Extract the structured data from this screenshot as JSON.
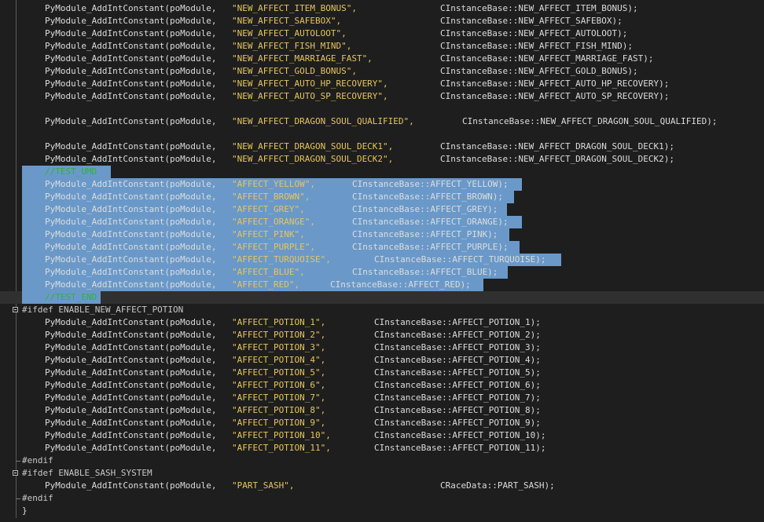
{
  "editor": {
    "lines": [
      {
        "kind": "call",
        "fn": "PyModule_AddIntConstant(poModule,",
        "str": "\"NEW_AFFECT_ITEM_BONUS\",",
        "ref": "CInstanceBase::NEW_AFFECT_ITEM_BONUS);"
      },
      {
        "kind": "call",
        "fn": "PyModule_AddIntConstant(poModule,",
        "str": "\"NEW_AFFECT_SAFEBOX\",",
        "ref": "CInstanceBase::NEW_AFFECT_SAFEBOX);"
      },
      {
        "kind": "call",
        "fn": "PyModule_AddIntConstant(poModule,",
        "str": "\"NEW_AFFECT_AUTOLOOT\",",
        "ref": "CInstanceBase::NEW_AFFECT_AUTOLOOT);"
      },
      {
        "kind": "call",
        "fn": "PyModule_AddIntConstant(poModule,",
        "str": "\"NEW_AFFECT_FISH_MIND\",",
        "ref": "CInstanceBase::NEW_AFFECT_FISH_MIND);"
      },
      {
        "kind": "call",
        "fn": "PyModule_AddIntConstant(poModule,",
        "str": "\"NEW_AFFECT_MARRIAGE_FAST\",",
        "ref": "CInstanceBase::NEW_AFFECT_MARRIAGE_FAST);"
      },
      {
        "kind": "call",
        "fn": "PyModule_AddIntConstant(poModule,",
        "str": "\"NEW_AFFECT_GOLD_BONUS\",",
        "ref": "CInstanceBase::NEW_AFFECT_GOLD_BONUS);"
      },
      {
        "kind": "call",
        "fn": "PyModule_AddIntConstant(poModule,",
        "str": "\"NEW_AFFECT_AUTO_HP_RECOVERY\",",
        "ref": "CInstanceBase::NEW_AFFECT_AUTO_HP_RECOVERY);"
      },
      {
        "kind": "call",
        "fn": "PyModule_AddIntConstant(poModule,",
        "str": "\"NEW_AFFECT_AUTO_SP_RECOVERY\",",
        "ref": "CInstanceBase::NEW_AFFECT_AUTO_SP_RECOVERY);"
      },
      {
        "kind": "blank"
      },
      {
        "kind": "call",
        "fn": "PyModule_AddIntConstant(poModule,",
        "str": "\"NEW_AFFECT_DRAGON_SOUL_QUALIFIED\",",
        "ref": "CInstanceBase::NEW_AFFECT_DRAGON_SOUL_QUALIFIED);"
      },
      {
        "kind": "blank"
      },
      {
        "kind": "call",
        "fn": "PyModule_AddIntConstant(poModule,",
        "str": "\"NEW_AFFECT_DRAGON_SOUL_DECK1\",",
        "ref": "CInstanceBase::NEW_AFFECT_DRAGON_SOUL_DECK1);"
      },
      {
        "kind": "call",
        "fn": "PyModule_AddIntConstant(poModule,",
        "str": "\"NEW_AFFECT_DRAGON_SOUL_DECK2\",",
        "ref": "CInstanceBase::NEW_AFFECT_DRAGON_SOUL_DECK2);"
      },
      {
        "kind": "comment",
        "text": "//TEST_UMD"
      },
      {
        "kind": "call",
        "fn": "PyModule_AddIntConstant(poModule,",
        "str": "\"AFFECT_YELLOW\",",
        "ref": "CInstanceBase::AFFECT_YELLOW);"
      },
      {
        "kind": "call",
        "fn": "PyModule_AddIntConstant(poModule,",
        "str": "\"AFFECT_BROWN\",",
        "ref": "CInstanceBase::AFFECT_BROWN);"
      },
      {
        "kind": "call",
        "fn": "PyModule_AddIntConstant(poModule,",
        "str": "\"AFFECT_GREY\",",
        "ref": "CInstanceBase::AFFECT_GREY);"
      },
      {
        "kind": "call",
        "fn": "PyModule_AddIntConstant(poModule,",
        "str": "\"AFFECT_ORANGE\",",
        "ref": "CInstanceBase::AFFECT_ORANGE);"
      },
      {
        "kind": "call",
        "fn": "PyModule_AddIntConstant(poModule,",
        "str": "\"AFFECT_PINK\",",
        "ref": "CInstanceBase::AFFECT_PINK);"
      },
      {
        "kind": "call",
        "fn": "PyModule_AddIntConstant(poModule,",
        "str": "\"AFFECT_PURPLE\",",
        "ref": "CInstanceBase::AFFECT_PURPLE);"
      },
      {
        "kind": "call",
        "fn": "PyModule_AddIntConstant(poModule,",
        "str": "\"AFFECT_TURQUOISE\",",
        "ref": "CInstanceBase::AFFECT_TURQUOISE);"
      },
      {
        "kind": "call",
        "fn": "PyModule_AddIntConstant(poModule,",
        "str": "\"AFFECT_BLUE\",",
        "ref": "CInstanceBase::AFFECT_BLUE);"
      },
      {
        "kind": "call",
        "fn": "PyModule_AddIntConstant(poModule,",
        "str": "\"AFFECT_RED\",",
        "ref": "CInstanceBase::AFFECT_RED);"
      },
      {
        "kind": "comment",
        "text": "//TEST_END"
      },
      {
        "kind": "pre",
        "text": "#ifdef ENABLE_NEW_AFFECT_POTION"
      },
      {
        "kind": "call",
        "fn": "PyModule_AddIntConstant(poModule,",
        "str": "\"AFFECT_POTION_1\",",
        "ref": "CInstanceBase::AFFECT_POTION_1);"
      },
      {
        "kind": "call",
        "fn": "PyModule_AddIntConstant(poModule,",
        "str": "\"AFFECT_POTION_2\",",
        "ref": "CInstanceBase::AFFECT_POTION_2);"
      },
      {
        "kind": "call",
        "fn": "PyModule_AddIntConstant(poModule,",
        "str": "\"AFFECT_POTION_3\",",
        "ref": "CInstanceBase::AFFECT_POTION_3);"
      },
      {
        "kind": "call",
        "fn": "PyModule_AddIntConstant(poModule,",
        "str": "\"AFFECT_POTION_4\",",
        "ref": "CInstanceBase::AFFECT_POTION_4);"
      },
      {
        "kind": "call",
        "fn": "PyModule_AddIntConstant(poModule,",
        "str": "\"AFFECT_POTION_5\",",
        "ref": "CInstanceBase::AFFECT_POTION_5);"
      },
      {
        "kind": "call",
        "fn": "PyModule_AddIntConstant(poModule,",
        "str": "\"AFFECT_POTION_6\",",
        "ref": "CInstanceBase::AFFECT_POTION_6);"
      },
      {
        "kind": "call",
        "fn": "PyModule_AddIntConstant(poModule,",
        "str": "\"AFFECT_POTION_7\",",
        "ref": "CInstanceBase::AFFECT_POTION_7);"
      },
      {
        "kind": "call",
        "fn": "PyModule_AddIntConstant(poModule,",
        "str": "\"AFFECT_POTION_8\",",
        "ref": "CInstanceBase::AFFECT_POTION_8);"
      },
      {
        "kind": "call",
        "fn": "PyModule_AddIntConstant(poModule,",
        "str": "\"AFFECT_POTION_9\",",
        "ref": "CInstanceBase::AFFECT_POTION_9);"
      },
      {
        "kind": "call",
        "fn": "PyModule_AddIntConstant(poModule,",
        "str": "\"AFFECT_POTION_10\",",
        "ref": "CInstanceBase::AFFECT_POTION_10);"
      },
      {
        "kind": "call",
        "fn": "PyModule_AddIntConstant(poModule,",
        "str": "\"AFFECT_POTION_11\",",
        "ref": "CInstanceBase::AFFECT_POTION_11);"
      },
      {
        "kind": "pre",
        "text": "#endif"
      },
      {
        "kind": "pre",
        "text": "#ifdef ENABLE_SASH_SYSTEM"
      },
      {
        "kind": "call",
        "fn": "PyModule_AddIntConstant(poModule,",
        "str": "\"PART_SASH\",",
        "ref": "CRaceData::PART_SASH);"
      },
      {
        "kind": "pre",
        "text": "#endif"
      },
      {
        "kind": "brace",
        "text": "}"
      }
    ]
  },
  "colors": {
    "background": "#1e1e1e",
    "selection": "#6a99c9",
    "current_line": "#303030",
    "string": "#e6c55e",
    "comment": "#30b040",
    "text": "#dcdcdc"
  }
}
